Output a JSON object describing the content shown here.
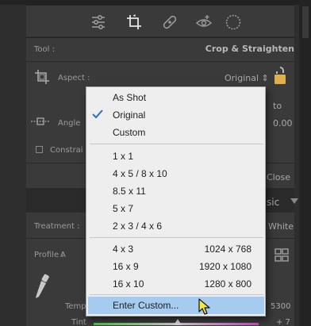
{
  "panel": {
    "tool_label": "Tool :",
    "tool_value": "Crop & Straighten",
    "aspect_label": "Aspect :",
    "aspect_value": "Original",
    "aspect_arrows": "⇕",
    "auto_partial": "to",
    "angle_label": "Angle",
    "angle_value": "0.00",
    "constrain_label": "Constrai",
    "close_partial": "Close",
    "basic_partial": "sic",
    "treatment_label": "Treatment :",
    "white_partial": "White",
    "profile_label": "Profile :",
    "profile_partial": "A",
    "temp_label": "Temp",
    "temp_value": "5300",
    "tint_label": "Tint",
    "tint_value": "+ 7"
  },
  "menu": {
    "items": [
      {
        "label": "As Shot",
        "right": ""
      },
      {
        "label": "Original",
        "right": "",
        "checked": true
      },
      {
        "label": "Custom",
        "right": ""
      },
      {
        "label": "1 x 1",
        "right": ""
      },
      {
        "label": "4 x 5  /  8 x 10",
        "right": ""
      },
      {
        "label": "8.5 x 11",
        "right": ""
      },
      {
        "label": "5 x 7",
        "right": ""
      },
      {
        "label": "2 x 3  /  4 x 6",
        "right": ""
      },
      {
        "label": "4 x 3",
        "right": "1024 x 768"
      },
      {
        "label": "16 x 9",
        "right": "1920 x 1080"
      },
      {
        "label": "16 x 10",
        "right": "1280 x 800"
      },
      {
        "label": "Enter Custom...",
        "right": "",
        "highlighted": true
      }
    ]
  },
  "colors": {
    "menu_bg": "#eeeeee",
    "menu_highlight": "#a5cbf0",
    "check": "#2f6fc8",
    "panel_bg": "#3a3a3a"
  }
}
